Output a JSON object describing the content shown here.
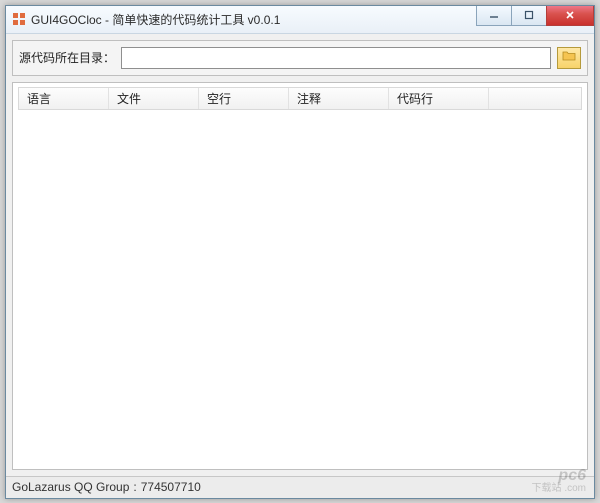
{
  "window": {
    "title": "GUI4GOCloc - 简单快速的代码统计工具 v0.0.1"
  },
  "dir": {
    "label": "源代码所在目录：",
    "value": ""
  },
  "table": {
    "columns": [
      "语言",
      "文件",
      "空行",
      "注释",
      "代码行"
    ],
    "rows": []
  },
  "status": {
    "group_label": "GoLazarus QQ Group",
    "group_number": "774507710"
  },
  "watermark": {
    "text": "pc6",
    "sub": "下载站 .com"
  }
}
